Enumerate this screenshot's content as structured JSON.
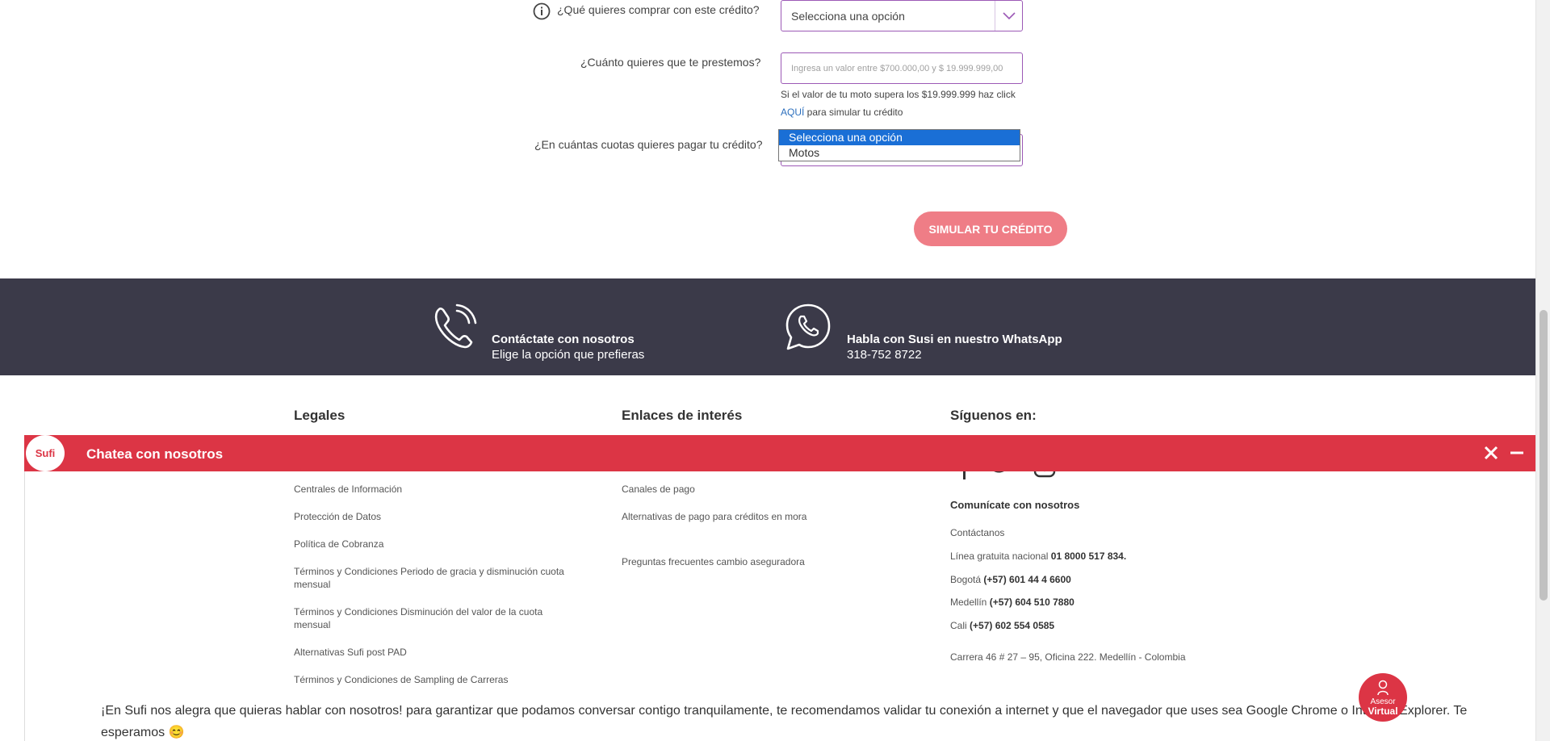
{
  "form": {
    "q_comprar": "¿Qué quieres comprar con este crédito?",
    "select_comprar_value": "Selecciona una opción",
    "q_prestemos": "¿Cuánto quieres que te prestemos?",
    "input_placeholder": "Ingresa un valor entre $700.000,00 y $ 19.999.999,00",
    "hint_line1": "Si el valor de tu moto supera los $19.999.999 haz click",
    "hint_link": "AQUÍ",
    "hint_line2": " para simular tu crédito",
    "q_cuotas": "¿En cuántas cuotas quieres pagar tu crédito?",
    "dropdown_options": [
      "Selecciona una opción",
      "Motos"
    ],
    "simular_button": "SIMULAR TU CRÉDITO"
  },
  "contact": {
    "phone_title": "Contáctate con nosotros",
    "phone_sub": "Elige la opción que prefieras",
    "whatsapp_title": "Habla con Susi en nuestro WhatsApp",
    "whatsapp_number": "318-752 8722"
  },
  "footer": {
    "legales_title": "Legales",
    "legales_links": [
      "Centrales de Información",
      "Protección de Datos",
      "Política de Cobranza",
      "Términos y Condiciones Periodo de gracia y disminución cuota mensual",
      "Términos y Condiciones Disminución del valor de la cuota mensual",
      "Alternativas Sufi post PAD",
      "Términos y Condiciones de Sampling de Carreras"
    ],
    "enlaces_title": "Enlaces de interés",
    "enlaces_links": [
      "Canales de pago",
      "Alternativas de pago para créditos en mora",
      "Preguntas frecuentes cambio aseguradora"
    ],
    "siguenos_title": "Síguenos en:",
    "comunicate_title": "Comunícate con nosotros",
    "contactanos": "Contáctanos",
    "linea_label": "Línea gratuita nacional ",
    "linea_number": "01 8000 517 834.",
    "bogota_label": "Bogotá ",
    "bogota_number": "(+57) 601 44 4 6600",
    "medellin_label": "Medellín ",
    "medellin_number": "(+57) 604 510 7880",
    "cali_label": "Cali ",
    "cali_number": "(+57) 602 554 0585",
    "address": "Carrera 46 # 27 – 95, Oficina 222. Medellín - Colombia"
  },
  "chat": {
    "logo_text": "Sufi",
    "title": "Chatea con nosotros",
    "message": "¡En Sufi nos alegra que quieras hablar con nosotros! para garantizar que podamos conversar contigo tranquilamente, te recomendamos validar tu conexión a internet y que el navegador que uses sea Google Chrome o Internet Explorer. Te esperamos 😊",
    "asesor_line1": "Asesor",
    "asesor_line2": "Virtual"
  },
  "colors": {
    "accent_red": "#dc3545",
    "dark_band": "#3b3a49",
    "button_pink": "#ef7d86",
    "select_border": "#9c59b6"
  }
}
